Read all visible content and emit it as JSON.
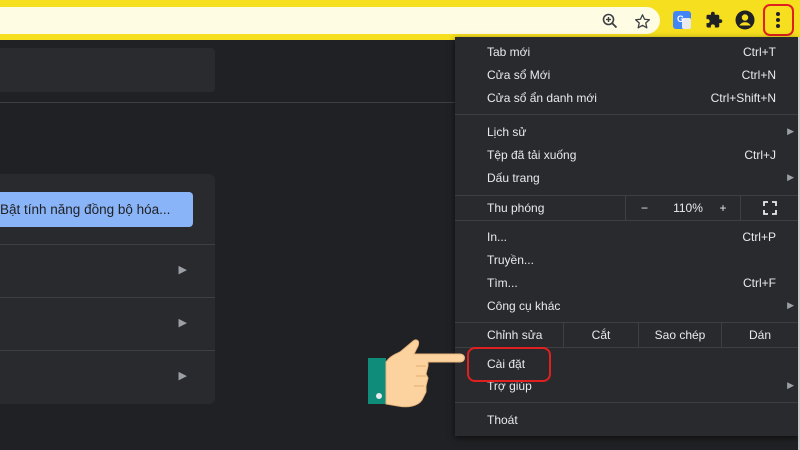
{
  "toolbar": {
    "icons": [
      "zoom-icon",
      "star-icon",
      "google-translate-icon",
      "extensions-icon",
      "profile-icon",
      "more-menu-icon"
    ]
  },
  "page": {
    "sync_button_label": "Bật tính năng đồng bộ hóa..."
  },
  "menu": {
    "items": [
      {
        "label": "Tab mới",
        "shortcut": "Ctrl+T"
      },
      {
        "label": "Cửa sổ Mới",
        "shortcut": "Ctrl+N"
      },
      {
        "label": "Cửa sổ ẩn danh mới",
        "shortcut": "Ctrl+Shift+N"
      },
      {
        "label": "Lịch sử",
        "shortcut": ""
      },
      {
        "label": "Tệp đã tải xuống",
        "shortcut": "Ctrl+J"
      },
      {
        "label": "Dấu trang",
        "shortcut": ""
      },
      {
        "label": "In...",
        "shortcut": "Ctrl+P"
      },
      {
        "label": "Truyền...",
        "shortcut": ""
      },
      {
        "label": "Tìm...",
        "shortcut": "Ctrl+F"
      },
      {
        "label": "Công cụ khác",
        "shortcut": ""
      },
      {
        "label": "Cài đặt",
        "shortcut": ""
      },
      {
        "label": "Trợ giúp",
        "shortcut": ""
      },
      {
        "label": "Thoát",
        "shortcut": ""
      }
    ],
    "zoom": {
      "label": "Thu phóng",
      "minus": "−",
      "value": "110%",
      "plus": "+"
    },
    "edit": {
      "label": "Chỉnh sửa",
      "cut": "Cắt",
      "copy": "Sao chép",
      "paste": "Dán"
    }
  },
  "colors": {
    "toolbar": "#f6df1e",
    "accent": "#8ab4f8",
    "highlight": "#e02020"
  }
}
